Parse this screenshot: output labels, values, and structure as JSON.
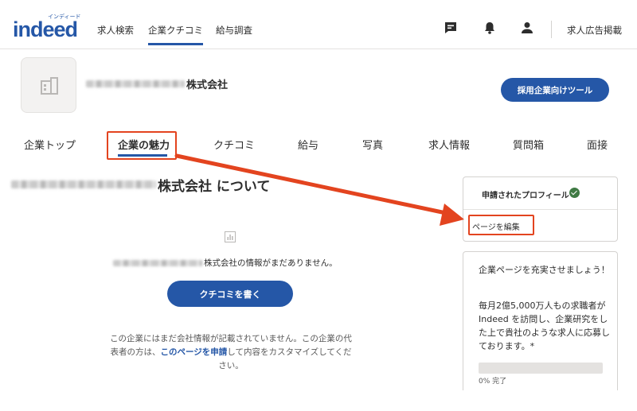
{
  "header": {
    "logo_main": "indeed",
    "logo_sub": "インディード",
    "nav": [
      "求人検索",
      "企業クチコミ",
      "給与調査"
    ],
    "active_nav": 1,
    "post_job_label": "求人広告掲載",
    "icons": [
      "message-icon",
      "bell-icon",
      "user-icon"
    ]
  },
  "company": {
    "name_suffix": "株式会社",
    "employer_tool_label": "採用企業向けツール"
  },
  "tabs": [
    "企業トップ",
    "企業の魅力",
    "クチコミ",
    "給与",
    "写真",
    "求人情報",
    "質問箱",
    "面接"
  ],
  "active_tab": 1,
  "main": {
    "about_title": "株式会社 について",
    "no_info_text": "株式会社の情報がまだありません。",
    "write_review_label": "クチコミを書く",
    "desc_part1": "この企業にはまだ会社情報が記載されていません。この企業の代表者の方は、",
    "desc_link": "このページを申請",
    "desc_part2": "して内容をカスタマイズしてください。"
  },
  "sidebar": {
    "claimed_title": "申請されたプロフィール",
    "edit_page_label": "ページを編集",
    "promo_title": "企業ページを充実させましょう！",
    "promo_body": "毎月2億5,000万人もの求職者が Indeed を訪問し、企業研究をした上で貴社のような求人に応募しております。*",
    "progress_percent": 0,
    "progress_label": "0% 完了"
  },
  "colors": {
    "brand": "#2557a7",
    "annotation": "#e3441f",
    "verified": "#3f7a44"
  }
}
